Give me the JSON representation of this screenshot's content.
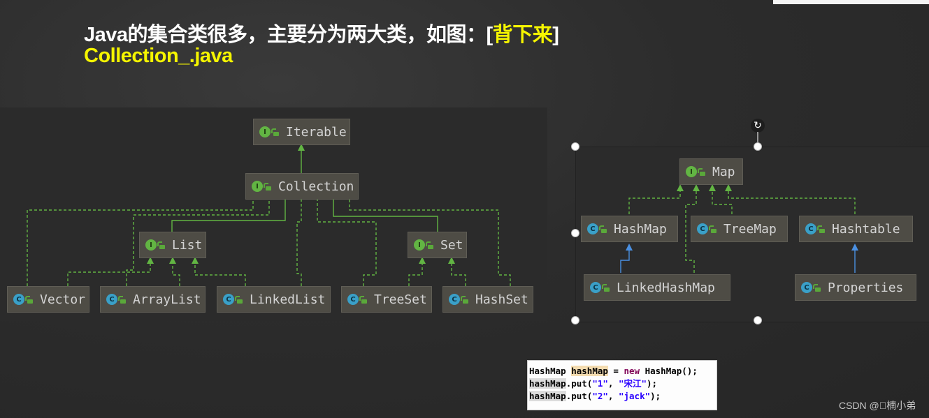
{
  "slide": {
    "headline_main": "Java的集合类很多，主要分为两大类，如图：",
    "headline_bracket_open": "[",
    "headline_highlight": "背下来",
    "headline_bracket_close": "]",
    "subline": "Collection_.java",
    "watermark": "CSDN @\u0000楠小弟"
  },
  "colors": {
    "background": "#2b2b2b",
    "node_fill": "#4e4c45",
    "interface_icon": "#62b543",
    "class_icon": "#3aa0c8",
    "implements_arrow": "#62b543",
    "extends_arrow": "#4a90e2",
    "highlight_text": "#f5f500"
  },
  "collection_diagram": {
    "nodes": [
      {
        "id": "Iterable",
        "label": "Iterable",
        "kind": "interface",
        "icon": "I"
      },
      {
        "id": "Collection",
        "label": "Collection",
        "kind": "interface",
        "icon": "I"
      },
      {
        "id": "List",
        "label": "List",
        "kind": "interface",
        "icon": "I"
      },
      {
        "id": "Set",
        "label": "Set",
        "kind": "interface",
        "icon": "I"
      },
      {
        "id": "Vector",
        "label": "Vector",
        "kind": "class",
        "icon": "C"
      },
      {
        "id": "ArrayList",
        "label": "ArrayList",
        "kind": "class",
        "icon": "C"
      },
      {
        "id": "LinkedList",
        "label": "LinkedList",
        "kind": "class",
        "icon": "C"
      },
      {
        "id": "TreeSet",
        "label": "TreeSet",
        "kind": "class",
        "icon": "C"
      },
      {
        "id": "HashSet",
        "label": "HashSet",
        "kind": "class",
        "icon": "C"
      }
    ],
    "edges": [
      {
        "from": "Collection",
        "to": "Iterable",
        "type": "extends-interface"
      },
      {
        "from": "List",
        "to": "Collection",
        "type": "extends-interface"
      },
      {
        "from": "Set",
        "to": "Collection",
        "type": "extends-interface"
      },
      {
        "from": "Vector",
        "to": "Collection",
        "type": "implements"
      },
      {
        "from": "ArrayList",
        "to": "Collection",
        "type": "implements"
      },
      {
        "from": "LinkedList",
        "to": "Collection",
        "type": "implements"
      },
      {
        "from": "TreeSet",
        "to": "Collection",
        "type": "implements"
      },
      {
        "from": "HashSet",
        "to": "Collection",
        "type": "implements"
      },
      {
        "from": "Vector",
        "to": "List",
        "type": "implements"
      },
      {
        "from": "ArrayList",
        "to": "List",
        "type": "implements"
      },
      {
        "from": "LinkedList",
        "to": "List",
        "type": "implements"
      },
      {
        "from": "TreeSet",
        "to": "Set",
        "type": "implements"
      },
      {
        "from": "HashSet",
        "to": "Set",
        "type": "implements"
      }
    ]
  },
  "map_diagram": {
    "nodes": [
      {
        "id": "Map",
        "label": "Map",
        "kind": "interface",
        "icon": "I"
      },
      {
        "id": "HashMap",
        "label": "HashMap",
        "kind": "class",
        "icon": "C"
      },
      {
        "id": "TreeMap",
        "label": "TreeMap",
        "kind": "class",
        "icon": "C"
      },
      {
        "id": "Hashtable",
        "label": "Hashtable",
        "kind": "class",
        "icon": "C"
      },
      {
        "id": "LinkedHashMap",
        "label": "LinkedHashMap",
        "kind": "class",
        "icon": "C"
      },
      {
        "id": "Properties",
        "label": "Properties",
        "kind": "class",
        "icon": "C"
      }
    ],
    "edges": [
      {
        "from": "HashMap",
        "to": "Map",
        "type": "implements"
      },
      {
        "from": "LinkedHashMap",
        "to": "Map",
        "type": "implements"
      },
      {
        "from": "TreeMap",
        "to": "Map",
        "type": "implements"
      },
      {
        "from": "Hashtable",
        "to": "Map",
        "type": "implements"
      },
      {
        "from": "LinkedHashMap",
        "to": "HashMap",
        "type": "extends"
      },
      {
        "from": "Properties",
        "to": "Hashtable",
        "type": "extends"
      }
    ]
  },
  "code_snippet": {
    "line1": {
      "type": "HashMap",
      "var": "hashMap",
      "eq": " = ",
      "kw": "new",
      "rest": " HashMap();"
    },
    "line2": {
      "var": "hashMap",
      "call": ".put(",
      "arg1": "\"1\"",
      "sep": ", ",
      "arg2": "\"宋江\"",
      "end": ");"
    },
    "line3": {
      "var": "hashMap",
      "call": ".put(",
      "arg1": "\"2\"",
      "sep": ", ",
      "arg2": "\"jack\"",
      "end": ");"
    }
  },
  "selection_handles": {
    "rotate_icon": "↻"
  }
}
